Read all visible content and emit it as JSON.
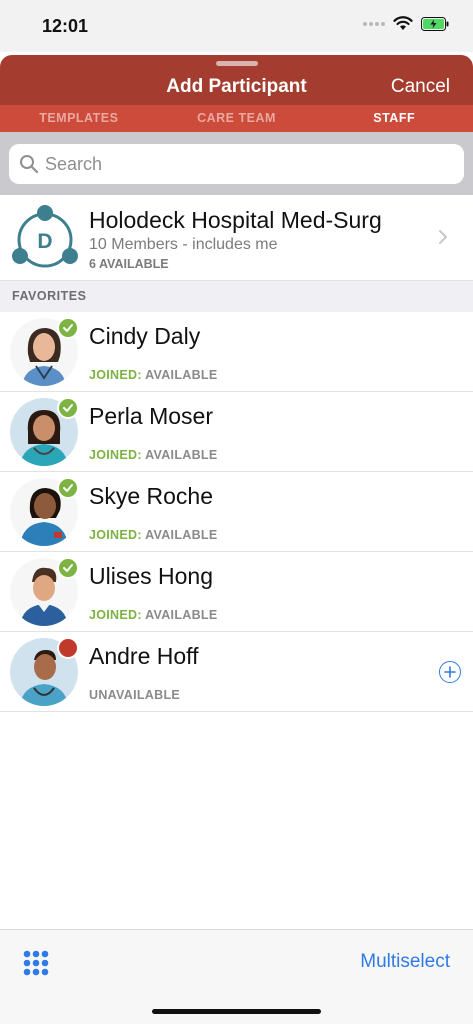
{
  "status_bar": {
    "time": "12:01"
  },
  "nav": {
    "title": "Add Participant",
    "cancel_label": "Cancel"
  },
  "tabs": [
    {
      "label": "TEMPLATES",
      "active": false
    },
    {
      "label": "CARE TEAM",
      "active": false
    },
    {
      "label": "STAFF",
      "active": true
    }
  ],
  "search": {
    "placeholder": "Search",
    "value": ""
  },
  "group": {
    "initial": "D",
    "name": "Holodeck Hospital Med-Surg",
    "members": "10 Members - includes me",
    "available": "6 AVAILABLE"
  },
  "section": {
    "favorites": "FAVORITES"
  },
  "favorites": [
    {
      "name": "Cindy Daly",
      "joined_label": "JOINED:",
      "status": "AVAILABLE",
      "presence": "available"
    },
    {
      "name": "Perla Moser",
      "joined_label": "JOINED:",
      "status": "AVAILABLE",
      "presence": "available"
    },
    {
      "name": "Skye Roche",
      "joined_label": "JOINED:",
      "status": "AVAILABLE",
      "presence": "available"
    },
    {
      "name": "Ulises Hong",
      "joined_label": "JOINED:",
      "status": "AVAILABLE",
      "presence": "available"
    },
    {
      "name": "Andre Hoff",
      "status": "UNAVAILABLE",
      "presence": "unavailable"
    }
  ],
  "bottom_bar": {
    "multiselect_label": "Multiselect"
  },
  "colors": {
    "nav_bar": "#a43d2f",
    "tab_bar": "#cc4b3b",
    "available_green": "#7cb342",
    "unavailable_red": "#c0392b",
    "link_blue": "#2f7ae5",
    "group_icon_teal": "#3d7f8f"
  },
  "icons": {
    "search": "search-icon",
    "chevron": "chevron-right-icon",
    "add": "add-icon",
    "keypad": "keypad-icon",
    "available_badge": "checkmark-icon"
  }
}
